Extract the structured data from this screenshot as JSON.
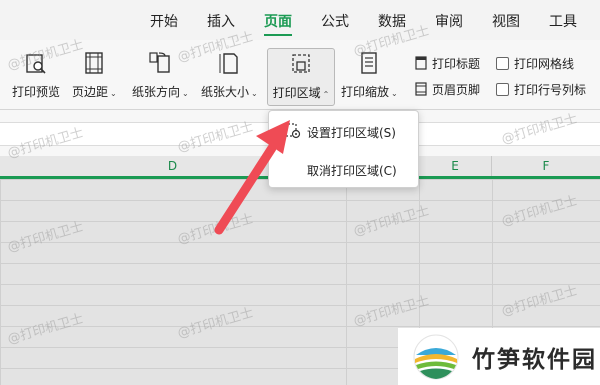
{
  "tabs": [
    {
      "label": "开始"
    },
    {
      "label": "插入"
    },
    {
      "label": "页面"
    },
    {
      "label": "公式"
    },
    {
      "label": "数据"
    },
    {
      "label": "审阅"
    },
    {
      "label": "视图"
    },
    {
      "label": "工具"
    }
  ],
  "active_tab": "页面",
  "ribbon": {
    "print_preview": "打印预览",
    "margins": "页边距",
    "orientation": "纸张方向",
    "paper_size": "纸张大小",
    "print_area": "打印区域",
    "print_scale": "打印缩放",
    "print_titles": "打印标题",
    "header_footer": "页眉页脚",
    "print_gridlines": "打印网格线",
    "print_row_col_headers": "打印行号列标",
    "caret": "⌄"
  },
  "columns": [
    "D",
    "E",
    "F"
  ],
  "print_area_menu": {
    "set": "设置打印区域(S)",
    "cancel": "取消打印区域(C)"
  },
  "watermark": "@打印机卫士",
  "logo": {
    "text": "竹笋软件园"
  },
  "colors": {
    "accent": "#1b9a53",
    "arrow": "#ef4b55"
  }
}
